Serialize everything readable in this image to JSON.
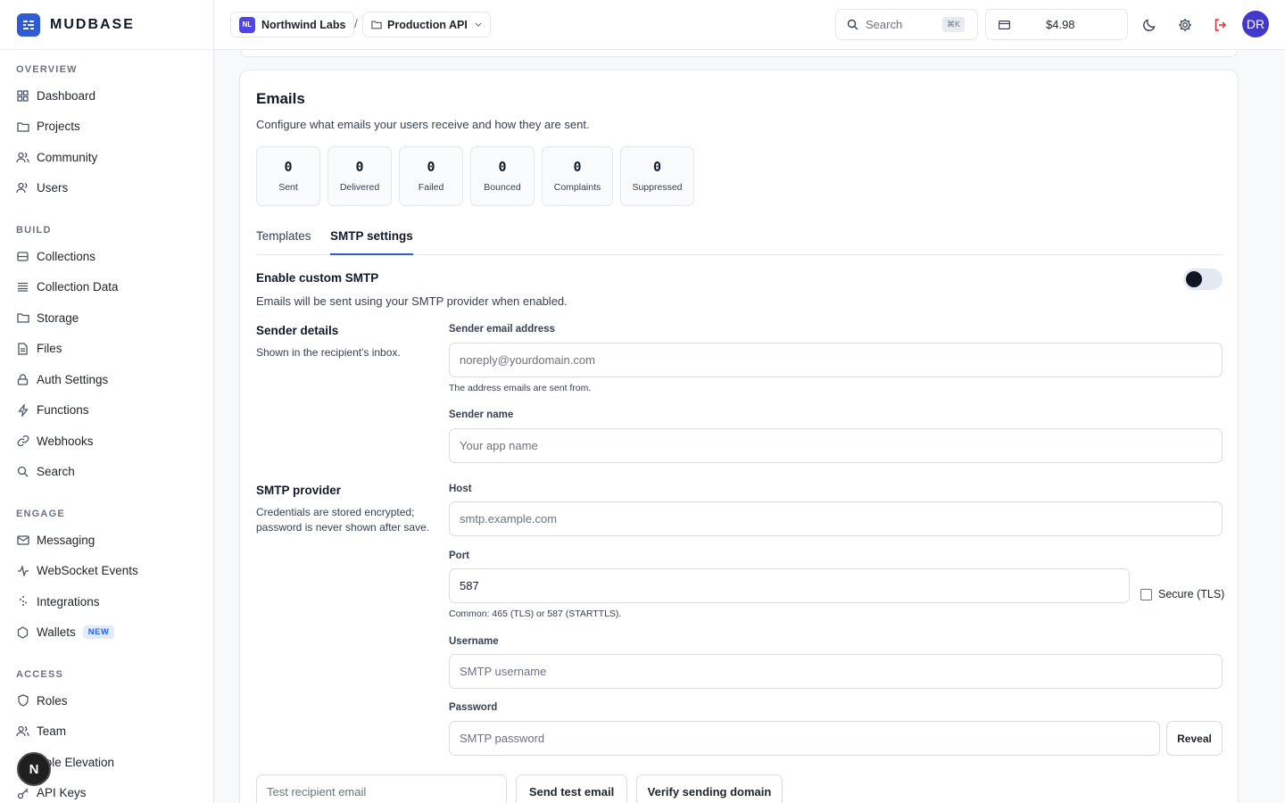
{
  "brand": {
    "name": "MUDBASE",
    "color": "#2f5bd3"
  },
  "sidebar": {
    "sections": [
      {
        "heading": "OVERVIEW",
        "items": [
          {
            "label": "Dashboard",
            "icon": "grid-icon"
          },
          {
            "label": "Projects",
            "icon": "folder-icon"
          },
          {
            "label": "Community",
            "icon": "users-icon"
          },
          {
            "label": "Users",
            "icon": "user-icon"
          }
        ]
      },
      {
        "heading": "BUILD",
        "items": [
          {
            "label": "Collections",
            "icon": "database-icon"
          },
          {
            "label": "Collection Data",
            "icon": "rows-icon"
          },
          {
            "label": "Storage",
            "icon": "folder-icon"
          },
          {
            "label": "Files",
            "icon": "file-icon"
          },
          {
            "label": "Auth Settings",
            "icon": "lock-icon"
          },
          {
            "label": "Functions",
            "icon": "bolt-icon"
          },
          {
            "label": "Webhooks",
            "icon": "link-icon"
          },
          {
            "label": "Search",
            "icon": "search-icon"
          }
        ]
      },
      {
        "heading": "ENGAGE",
        "items": [
          {
            "label": "Messaging",
            "icon": "mail-icon"
          },
          {
            "label": "WebSocket Events",
            "icon": "activity-icon"
          },
          {
            "label": "Integrations",
            "icon": "plug-icon"
          },
          {
            "label": "Wallets",
            "icon": "hexagon-icon",
            "badge": "NEW"
          }
        ]
      },
      {
        "heading": "ACCESS",
        "items": [
          {
            "label": "Roles",
            "icon": "shield-icon"
          },
          {
            "label": "Team",
            "icon": "users-icon"
          },
          {
            "label": "Role Elevation",
            "icon": "arrow-up-icon"
          },
          {
            "label": "API Keys",
            "icon": "key-icon"
          }
        ]
      }
    ],
    "floating_badge": "N"
  },
  "topbar": {
    "org_initials": "NL",
    "org_name": "Northwind Labs",
    "separator": "/",
    "project_name": "Production API",
    "search_placeholder": "Search",
    "search_shortcut": "⌘K",
    "credit": "$4.98",
    "avatar_initials": "DR"
  },
  "emails": {
    "title": "Emails",
    "subtitle": "Configure what emails your users receive and how they are sent.",
    "stats": [
      {
        "value": "0",
        "label": "Sent"
      },
      {
        "value": "0",
        "label": "Delivered"
      },
      {
        "value": "0",
        "label": "Failed"
      },
      {
        "value": "0",
        "label": "Bounced"
      },
      {
        "value": "0",
        "label": "Complaints"
      },
      {
        "value": "0",
        "label": "Suppressed"
      }
    ],
    "tabs": [
      {
        "label": "Templates",
        "active": false
      },
      {
        "label": "SMTP settings",
        "active": true
      }
    ],
    "enable_smtp": {
      "title": "Enable custom SMTP",
      "description": "Emails will be sent using your SMTP provider when enabled.",
      "enabled": false
    },
    "sender": {
      "title": "Sender details",
      "description": "Shown in the recipient's inbox.",
      "email_label": "Sender email address",
      "email_placeholder": "noreply@yourdomain.com",
      "email_help": "The address emails are sent from.",
      "name_label": "Sender name",
      "name_placeholder": "Your app name"
    },
    "provider": {
      "title": "SMTP provider",
      "description_line1": "Credentials are stored encrypted;",
      "description_line2": "password is never shown after save.",
      "host_label": "Host",
      "host_placeholder": "smtp.example.com",
      "port_label": "Port",
      "port_value": "587",
      "secure_label": "Secure (TLS)",
      "secure_checked": false,
      "port_help": "Common: 465 (TLS) or 587 (STARTTLS).",
      "username_label": "Username",
      "username_placeholder": "SMTP username",
      "password_label": "Password",
      "password_placeholder": "SMTP password",
      "reveal_label": "Reveal"
    },
    "test": {
      "recipient_placeholder": "Test recipient email",
      "send_label": "Send test email",
      "verify_label": "Verify sending domain"
    }
  }
}
